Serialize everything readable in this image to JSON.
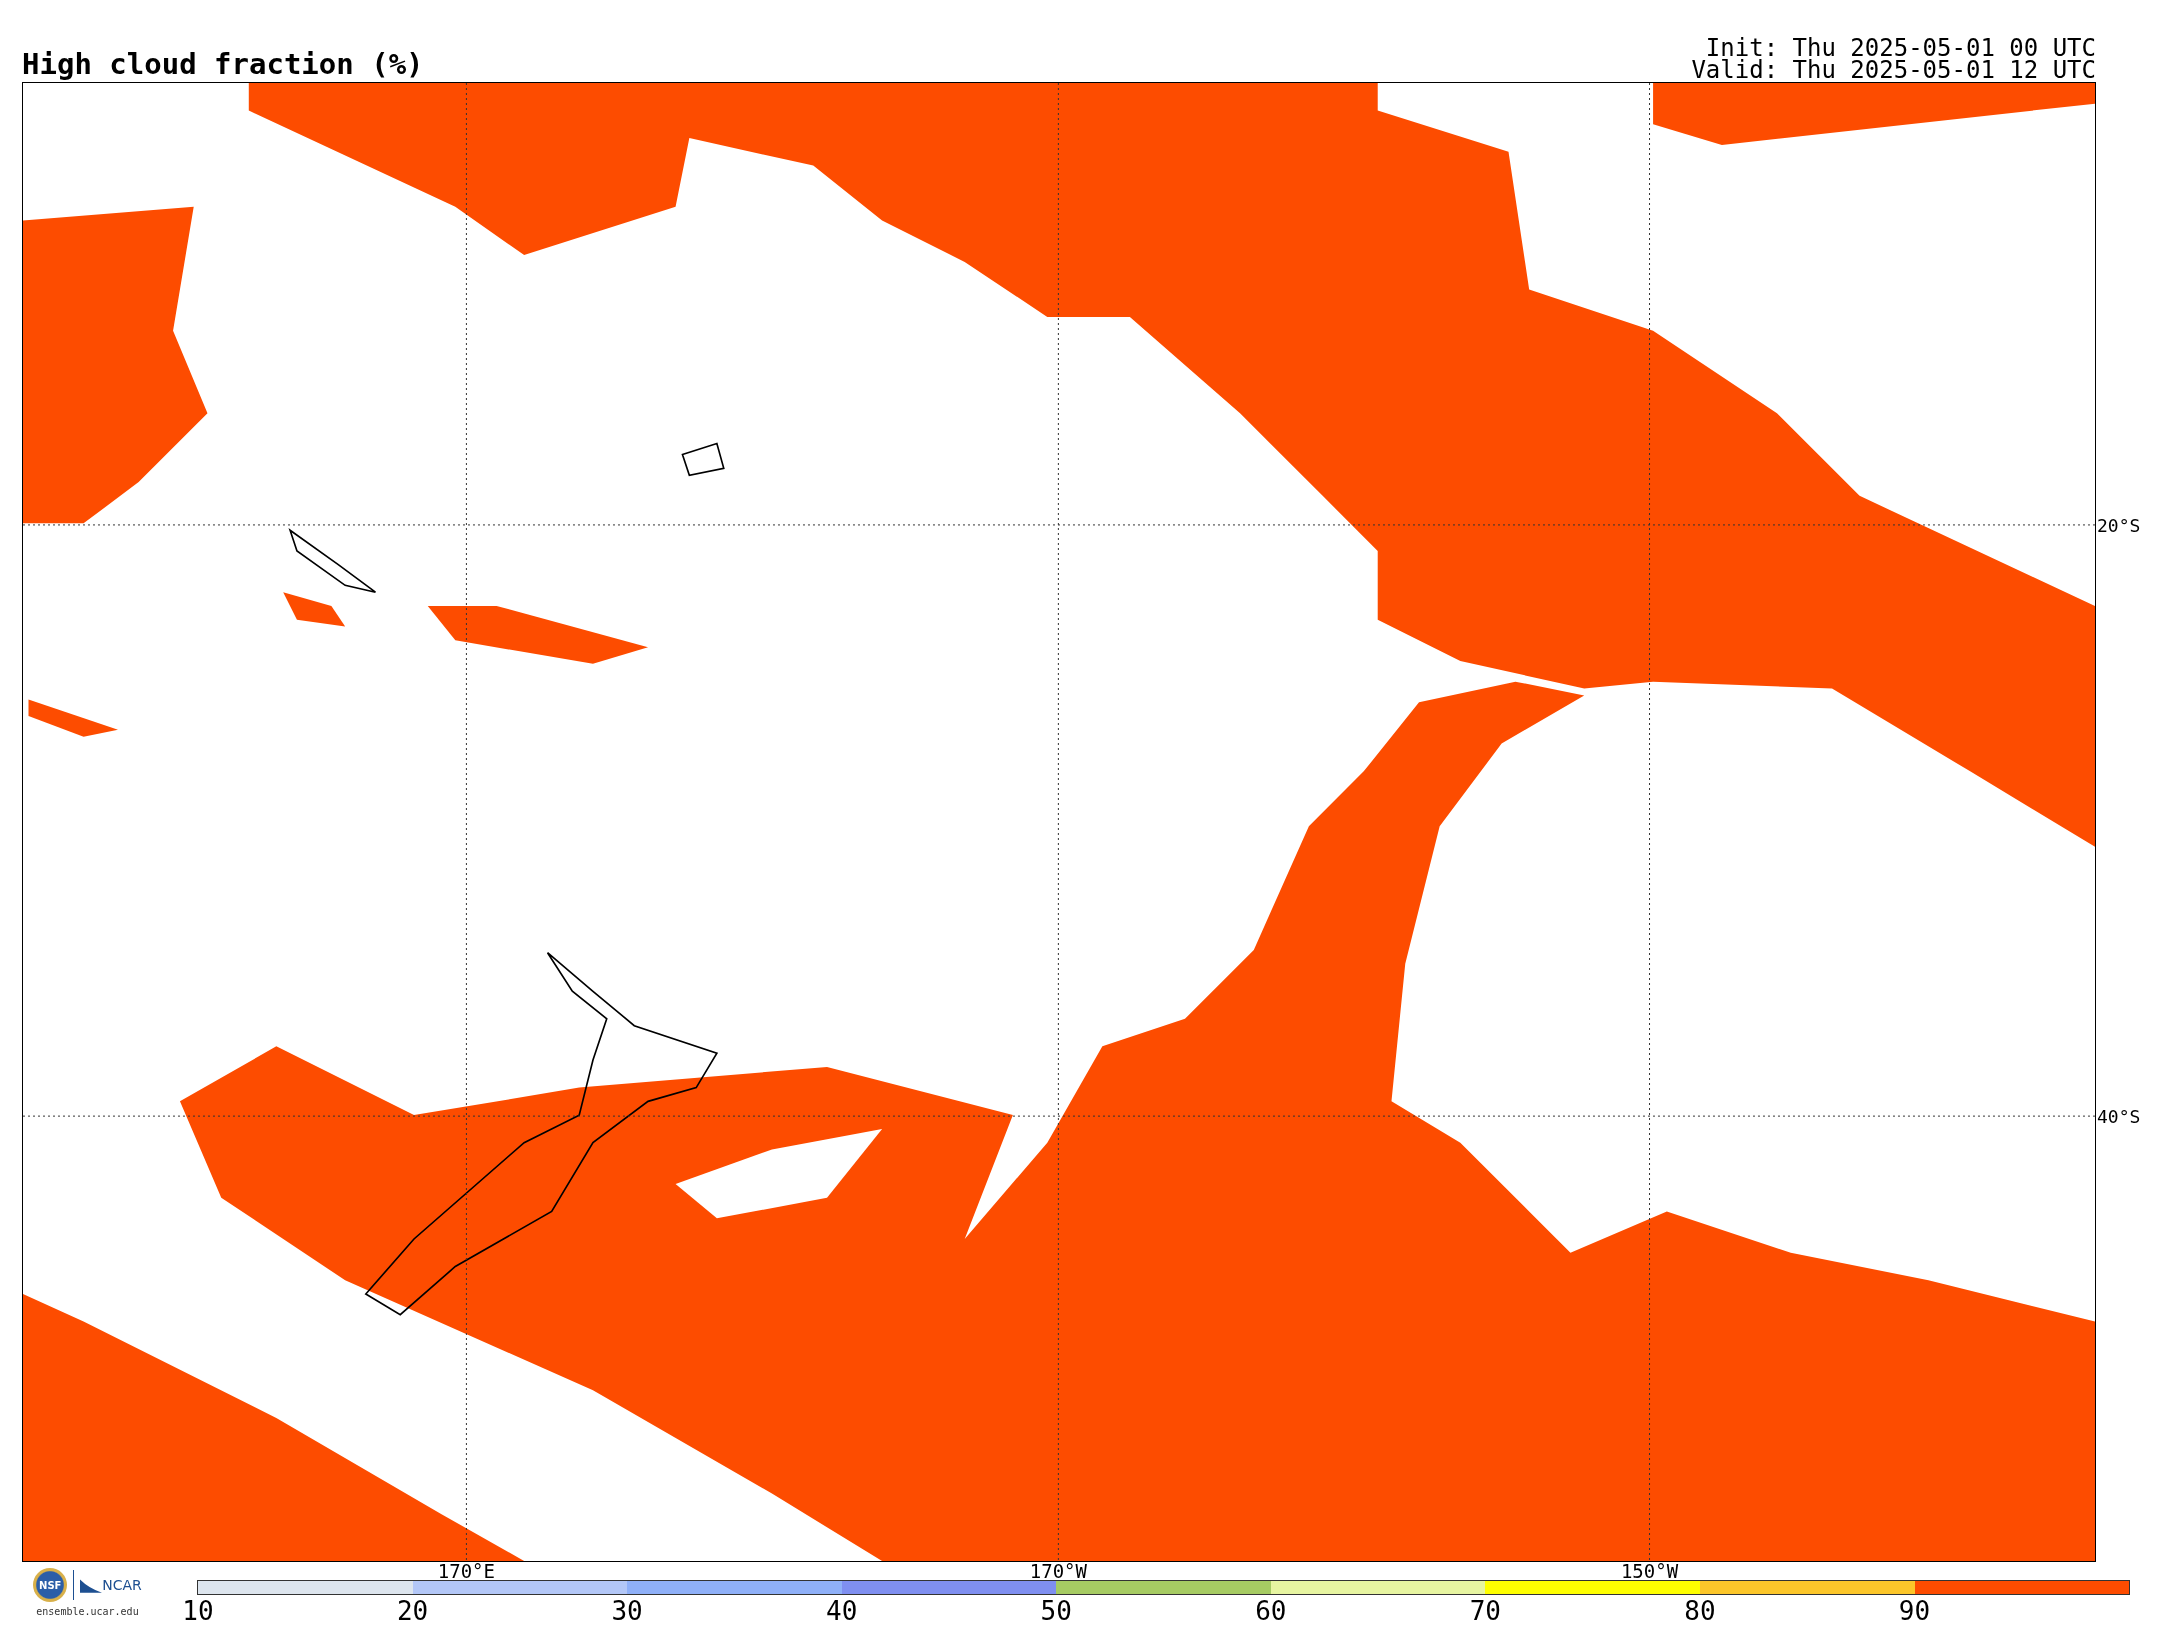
{
  "title": "High cloud fraction (%)",
  "run_info": [
    "Init: Thu 2025-05-01 00 UTC",
    "Valid: Thu 2025-05-01 12 UTC"
  ],
  "map": {
    "latitude_labels": [
      "20°S",
      "40°S"
    ],
    "longitude_labels": [
      "170°E",
      "170°W",
      "150°W"
    ]
  },
  "logos": {
    "nsf": "NSF",
    "ncar": "NCAR",
    "site": "ensemble.ucar.edu"
  },
  "colorbar": {
    "segments": [
      {
        "color": "#dde5ee",
        "tick": "10"
      },
      {
        "color": "#b3c7f7",
        "tick": "20"
      },
      {
        "color": "#8fb0f8",
        "tick": "30"
      },
      {
        "color": "#7f8ff0",
        "tick": "40"
      },
      {
        "color": "#a6cb63",
        "tick": "50"
      },
      {
        "color": "#e7f5a1",
        "tick": "60"
      },
      {
        "color": "#ffff00",
        "tick": "70"
      },
      {
        "color": "#fcc62a",
        "tick": "80"
      },
      {
        "color": "#fd4c00",
        "tick": "90"
      }
    ]
  }
}
